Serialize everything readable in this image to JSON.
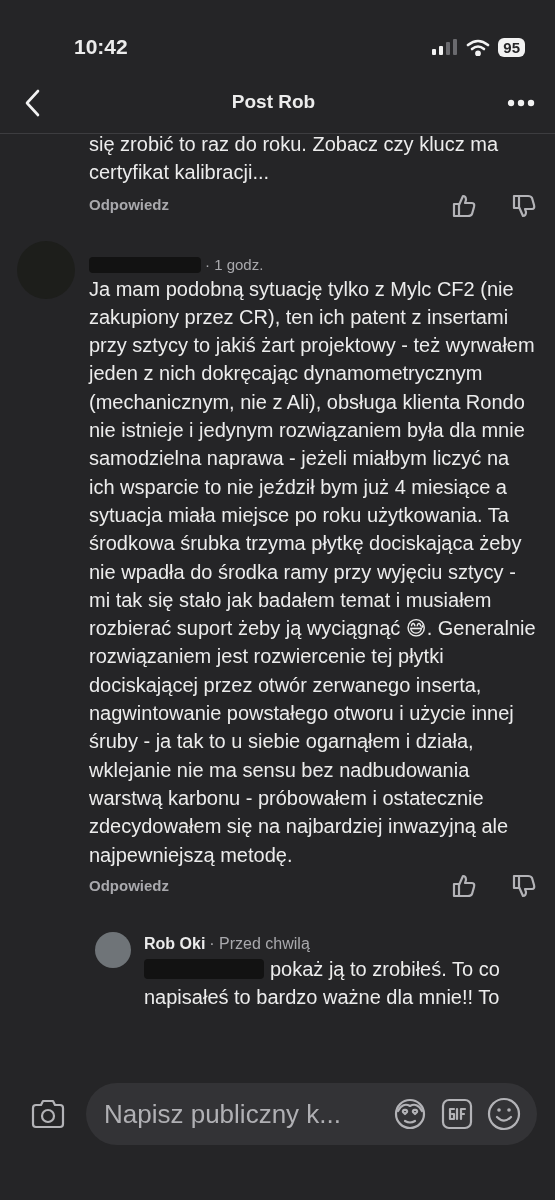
{
  "status_bar": {
    "time": "10:42",
    "battery": "95"
  },
  "header": {
    "title": "Post Rob"
  },
  "comments": [
    {
      "kind": "cut",
      "text": "się zrobić to raz do roku. Zobacz czy klucz ma certyfikat kalibracji...",
      "reply_label": "Odpowiedz"
    },
    {
      "kind": "full",
      "name_redacted": true,
      "time": "· 1 godz.",
      "text": "Ja mam podobną sytuację tylko z Mylc CF2 (nie zakupiony przez CR), ten ich patent z insertami przy sztycy to jakiś żart projektowy - też wyrwałem jeden z nich dokręcając dynamometrycznym (mechanicznym, nie z Ali), obsługa klienta Rondo nie istnieje i jedynym rozwiązaniem była dla mnie samodzielna naprawa - jeżeli miałbym liczyć na ich wsparcie to nie jeździł bym już 4 miesiące a sytuacja miała miejsce po roku użytkowania. Ta środkowa śrubka trzyma płytkę dociskająca żeby nie wpadła do środka ramy przy wyjęciu sztycy - mi tak się stało jak badałem temat i musiałem rozbierać suport żeby ją wyciągnąć 😅. Generalnie rozwiązaniem jest rozwiercenie tej płytki dociskającej przez otwór zerwanego inserta, nagwintowanie powstałego otworu i użycie innej śruby - ja tak to u siebie ogarnąłem i działa, wklejanie nie ma sensu bez nadbudowania warstwą karbonu - próbowałem i ostatecznie zdecydowałem się na najbardziej inwazyjną ale najpewniejszą metodę.",
      "reply_label": "Odpowiedz",
      "replies": [
        {
          "author": "Rob Oki",
          "time": "· Przed chwilą",
          "text_redacted": true,
          "text": "pokaż ją to zrobiłeś. To co napisałeś to bardzo ważne dla mnie!! To"
        }
      ]
    }
  ],
  "composer": {
    "placeholder": "Napisz publiczny k..."
  }
}
